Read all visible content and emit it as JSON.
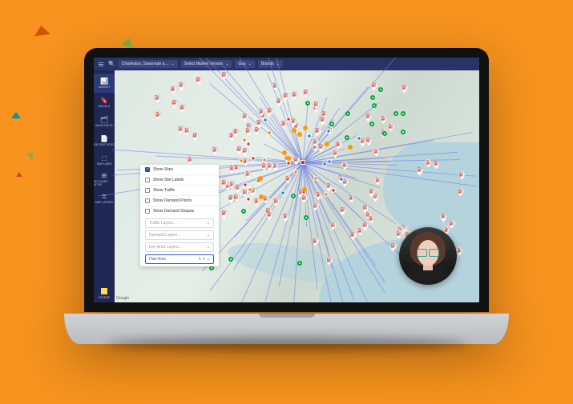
{
  "topbar": {
    "market": "Charleston, Savannah a…",
    "version": "Select Market Version",
    "category": "Gas",
    "brands": "Brands"
  },
  "sidebar": {
    "items": [
      {
        "icon": "📊",
        "label": "MARKET"
      },
      {
        "icon": "🔖",
        "label": "MODELS"
      },
      {
        "icon": "🗂",
        "label": "MASS EDITS"
      },
      {
        "icon": "📄",
        "label": "RECENT SITES"
      },
      {
        "icon": "⬚",
        "label": "MAP LINES"
      },
      {
        "icon": "⊞",
        "label": "MY SAVED SITES"
      },
      {
        "icon": "≣",
        "label": "MAP LAYERS"
      }
    ],
    "footer": "LEGEND"
  },
  "panel": {
    "checks": [
      {
        "label": "Show Sites",
        "on": true
      },
      {
        "label": "Show Site Labels",
        "on": false
      },
      {
        "label": "Show Traffic",
        "on": false
      },
      {
        "label": "Show Demand Points",
        "on": false
      },
      {
        "label": "Show Demand Shapes",
        "on": false
      }
    ],
    "selects": [
      {
        "label": "Traffic Layers…",
        "active": false
      },
      {
        "label": "Demand Layers…",
        "active": false
      },
      {
        "label": "Key Area Layers…",
        "active": false
      },
      {
        "label": "Hub lines",
        "active": true,
        "count": "1"
      }
    ]
  },
  "map": {
    "attribution": "Google"
  }
}
